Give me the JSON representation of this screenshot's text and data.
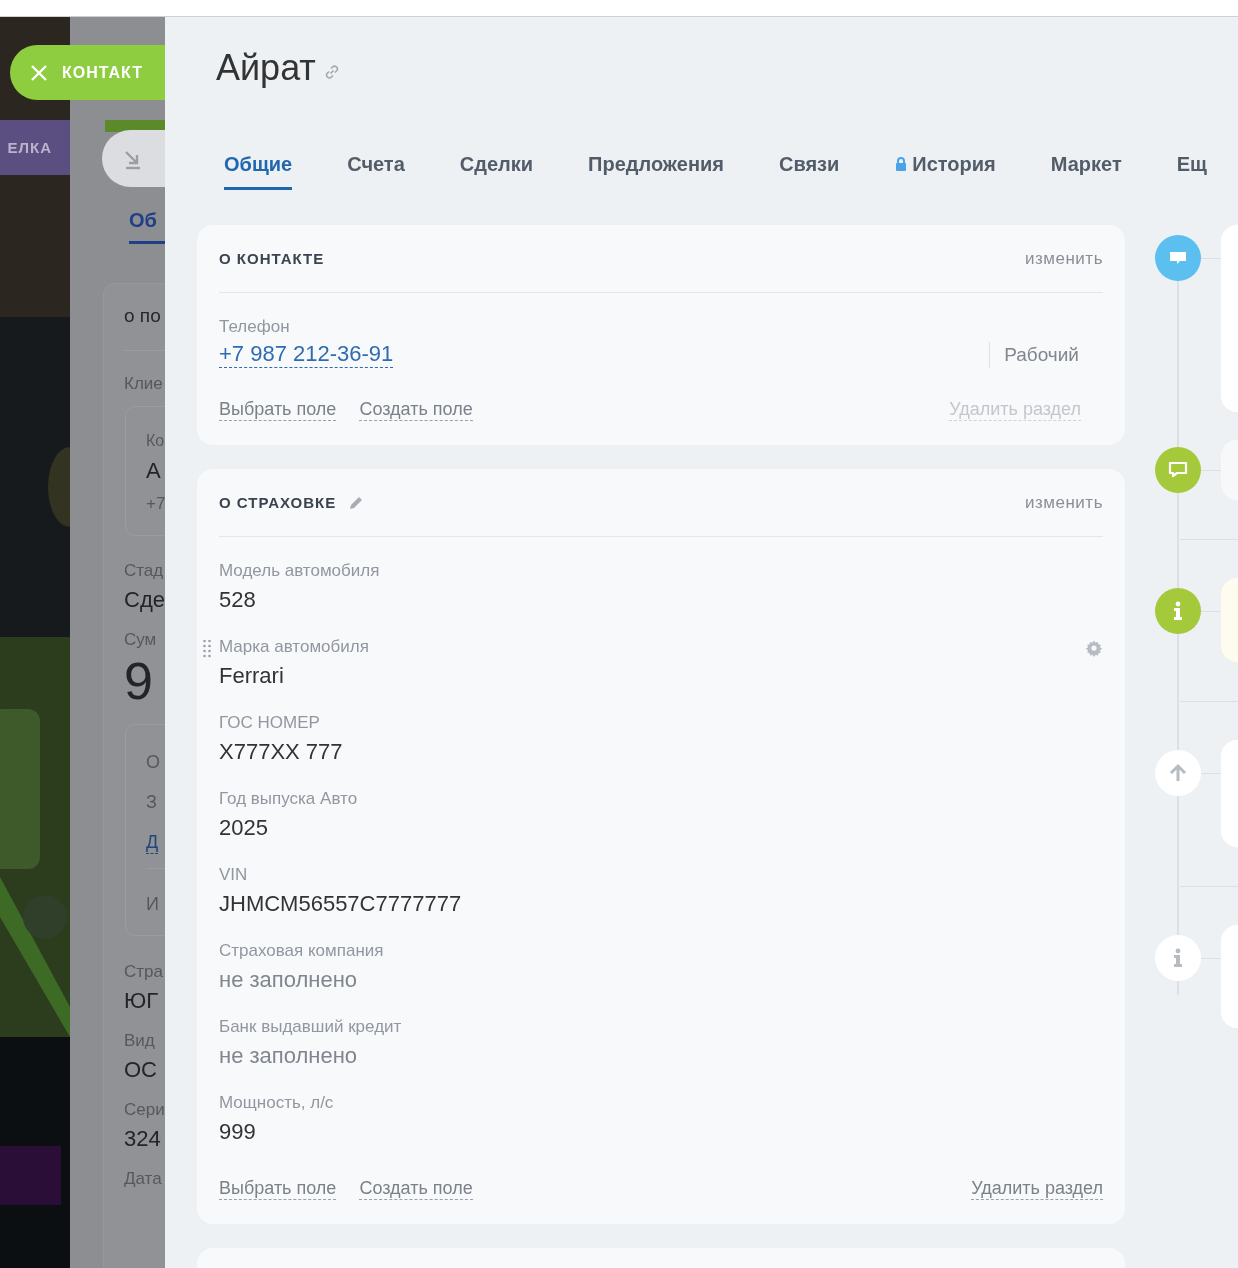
{
  "background_page": {
    "close_button": "КОНТАКТ",
    "deal_tab": "ЕЛКА",
    "tab": "Об",
    "section_title": "о по",
    "client_label": "Клие",
    "client_card": {
      "label": "Ко",
      "name": "А",
      "phone": "+7"
    },
    "stage": {
      "label": "Стад",
      "value": "Сде"
    },
    "sum": {
      "label": "Сум",
      "value": "9"
    },
    "sum_card": {
      "rows": [
        "О",
        "З"
      ],
      "link": "Д",
      "total": "И"
    },
    "fields": [
      {
        "label": "Стра",
        "value": "ЮГ"
      },
      {
        "label": "Вид",
        "value": "ОС"
      },
      {
        "label": "Сери",
        "value": "324"
      },
      {
        "label": "Дата"
      }
    ]
  },
  "contact": {
    "name": "Айрат",
    "tabs": [
      {
        "label": "Общие",
        "selected": true,
        "locked": false
      },
      {
        "label": "Счета",
        "selected": false,
        "locked": false
      },
      {
        "label": "Сделки",
        "selected": false,
        "locked": false
      },
      {
        "label": "Предложения",
        "selected": false,
        "locked": false
      },
      {
        "label": "Связи",
        "selected": false,
        "locked": false
      },
      {
        "label": "История",
        "selected": false,
        "locked": true
      },
      {
        "label": "Маркет",
        "selected": false,
        "locked": false
      },
      {
        "label": "Ещ",
        "selected": false,
        "locked": false
      }
    ],
    "sections": [
      {
        "title": "О КОНТАКТЕ",
        "editable_title": false,
        "edit": "изменить",
        "fields": [
          {
            "kind": "phone",
            "label": "Телефон",
            "value": "+7 987 212-36-91",
            "type": "Рабочий",
            "hovered": false
          }
        ],
        "actions": {
          "choose": "Выбрать поле",
          "create": "Создать поле",
          "delete": "Удалить раздел",
          "delete_disabled": true
        }
      },
      {
        "title": "О СТРАХОВКЕ",
        "editable_title": true,
        "edit": "изменить",
        "fields": [
          {
            "kind": "text",
            "label": "Модель автомобиля",
            "value": "528",
            "hovered": false
          },
          {
            "kind": "text",
            "label": "Марка автомобиля",
            "value": "Ferrari",
            "hovered": true
          },
          {
            "kind": "text",
            "label": "ГОС НОМЕР",
            "value": "Х777ХХ 777",
            "hovered": false
          },
          {
            "kind": "text",
            "label": "Год выпуска Авто",
            "value": "2025",
            "hovered": false
          },
          {
            "kind": "text",
            "label": "VIN",
            "value": "JHMCM56557C7777777",
            "hovered": false
          },
          {
            "kind": "empty",
            "label": "Страховая компания",
            "value": "не заполнено",
            "hovered": false
          },
          {
            "kind": "empty",
            "label": "Банк выдавший кредит",
            "value": "не заполнено",
            "hovered": false
          },
          {
            "kind": "text",
            "label": "Мощность, л/с",
            "value": "999",
            "hovered": false
          }
        ],
        "actions": {
          "choose": "Выбрать поле",
          "create": "Создать поле",
          "delete": "Удалить раздел",
          "delete_disabled": false
        }
      }
    ],
    "timeline": [
      {
        "kind": "comment"
      },
      {
        "kind": "chat"
      },
      {
        "kind": "info"
      },
      {
        "kind": "upload"
      },
      {
        "kind": "note"
      }
    ]
  }
}
